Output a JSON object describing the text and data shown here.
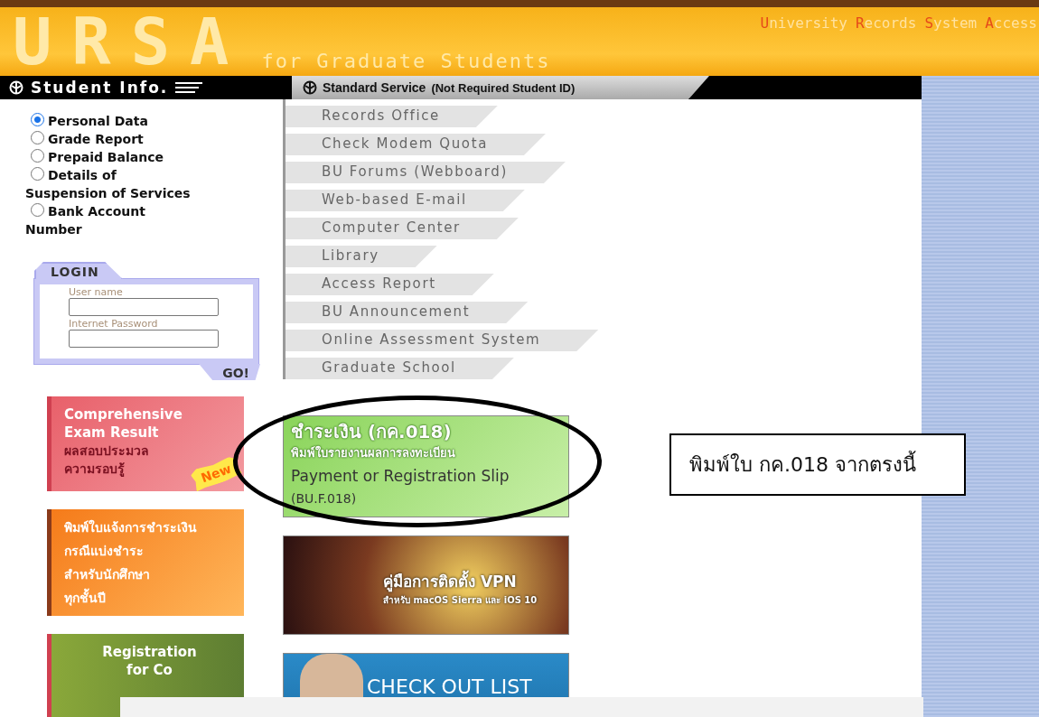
{
  "header": {
    "logo": "URSA",
    "subtitle": "for Graduate Students",
    "system_name": "University Records System Access"
  },
  "nav": {
    "student_tab": "Student Info.",
    "service_tab": "Standard Service",
    "service_note": "(Not Required Student ID)"
  },
  "student_options": [
    {
      "label": "Personal Data",
      "selected": true
    },
    {
      "label": "Grade Report",
      "selected": false
    },
    {
      "label": "Prepaid Balance",
      "selected": false
    },
    {
      "label": "Details of Suspension of Services",
      "selected": false
    },
    {
      "label": "Bank Account Number",
      "selected": false
    }
  ],
  "login": {
    "title": "LOGIN",
    "fields": [
      {
        "label": "User name"
      },
      {
        "label": "Internet Password"
      }
    ],
    "submit": "GO!"
  },
  "services": [
    {
      "label": "Records Office"
    },
    {
      "label": "Check Modem Quota"
    },
    {
      "label": "BU Forums (Webboard)"
    },
    {
      "label": "Web-based E-mail"
    },
    {
      "label": "Computer Center"
    },
    {
      "label": "Library"
    },
    {
      "label": "Access Report"
    },
    {
      "label": "BU Announcement"
    },
    {
      "label": "Online Assessment System"
    },
    {
      "label": "Graduate School"
    }
  ],
  "left_banners": [
    {
      "kind": "exam",
      "lines": [
        "Comprehensive",
        "Exam Result",
        "ผลสอบประมวล",
        "ความรอบรู้"
      ],
      "badge": "New"
    },
    {
      "kind": "payment",
      "lines": [
        "พิมพ์ใบแจ้งการชำระเงิน",
        "กรณีแบ่งชำระ",
        "สำหรับนักศึกษา",
        "ทุกชั้นปี"
      ]
    },
    {
      "kind": "registration",
      "lines": [
        "Registration",
        "for Co"
      ]
    }
  ],
  "main_banners": [
    {
      "kind": "slip",
      "lines": [
        "ชำระเงิน (กค.018)",
        "พิมพ์ใบรายงานผลการลงทะเบียน",
        "Payment or Registration Slip",
        "(BU.F.018)"
      ],
      "circled": true
    },
    {
      "kind": "vpn",
      "lines": [
        "คู่มือการติดตั้ง VPN",
        "สำหรับ macOS Sierra และ iOS 10"
      ],
      "circled": false
    },
    {
      "kind": "checkout",
      "lines": [
        "CHECK OUT LIST"
      ],
      "circled": false
    }
  ],
  "callout": {
    "text": "พิมพ์ใบ กค.018 จากตรงนี้"
  }
}
